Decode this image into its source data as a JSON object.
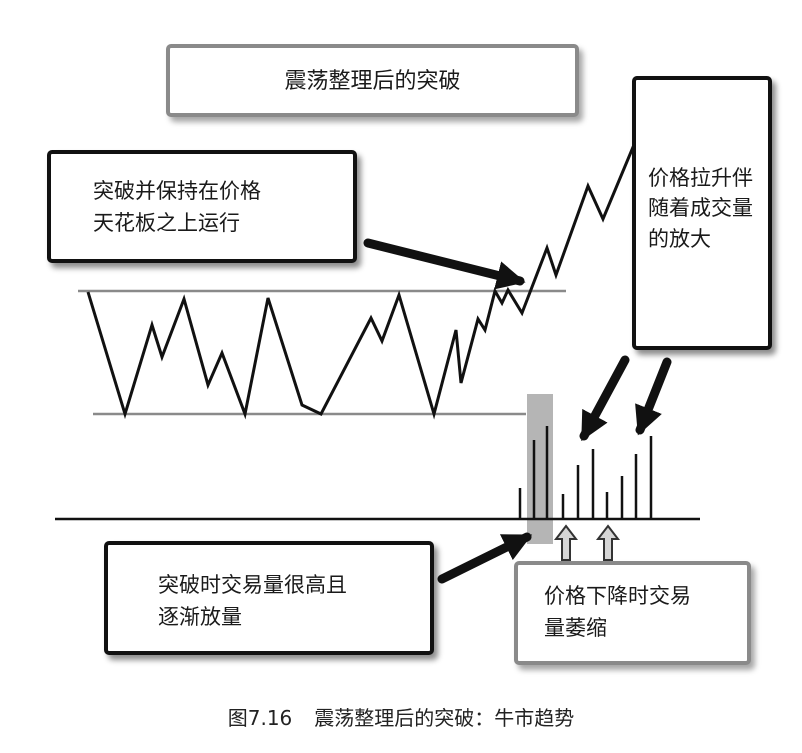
{
  "diagram": {
    "title": "震荡整理后的突破",
    "callouts": {
      "breakout": [
        "突破并保持在价格",
        "天花板之上运行"
      ],
      "price_rise": [
        "价格拉升伴",
        "随着成交量",
        "的放大"
      ],
      "volume_high": [
        "突破时交易量很高且",
        "逐渐放量"
      ],
      "volume_shrink": [
        "价格下降时交易",
        "量萎缩"
      ]
    },
    "caption": {
      "number": "图7.16",
      "text": "震荡整理后的突破：牛市趋势"
    },
    "colors": {
      "price_line": "#111111",
      "support_resistance": "#8a8a8a",
      "highlight": "#b5b5b5",
      "arrow": "#111111",
      "up_arrow_fill": "#d6d6d6"
    }
  }
}
